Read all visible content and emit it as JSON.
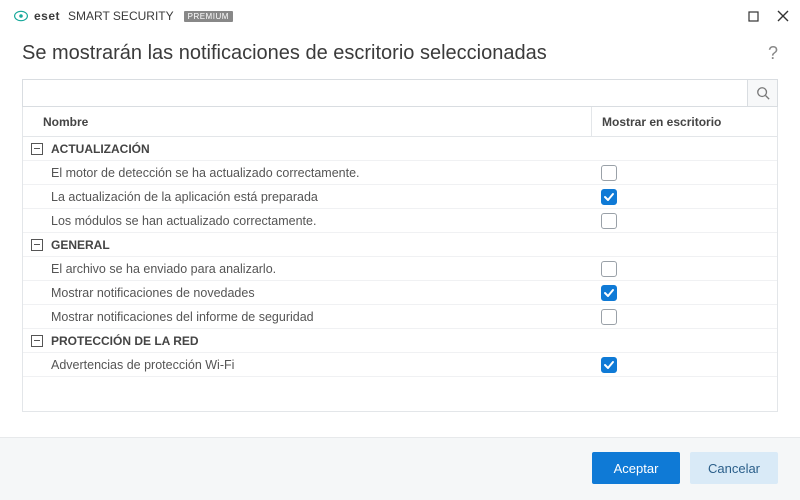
{
  "brand": {
    "eset": "eset",
    "product": "SMART SECURITY",
    "tier": "PREMIUM"
  },
  "header": {
    "title": "Se mostrarán las notificaciones de escritorio seleccionadas"
  },
  "search": {
    "value": "",
    "placeholder": ""
  },
  "table": {
    "columns": {
      "name": "Nombre",
      "show": "Mostrar en escritorio"
    },
    "groups": [
      {
        "label": "ACTUALIZACIÓN",
        "items": [
          {
            "label": "El motor de detección se ha actualizado correctamente.",
            "checked": false
          },
          {
            "label": "La actualización de la aplicación está preparada",
            "checked": true
          },
          {
            "label": "Los módulos se han actualizado correctamente.",
            "checked": false
          }
        ]
      },
      {
        "label": "GENERAL",
        "items": [
          {
            "label": "El archivo se ha enviado para analizarlo.",
            "checked": false
          },
          {
            "label": "Mostrar notificaciones de novedades",
            "checked": true
          },
          {
            "label": "Mostrar notificaciones del informe de seguridad",
            "checked": false
          }
        ]
      },
      {
        "label": "PROTECCIÓN DE LA RED",
        "items": [
          {
            "label": "Advertencias de protección Wi-Fi",
            "checked": true
          }
        ]
      }
    ]
  },
  "footer": {
    "accept": "Aceptar",
    "cancel": "Cancelar"
  }
}
